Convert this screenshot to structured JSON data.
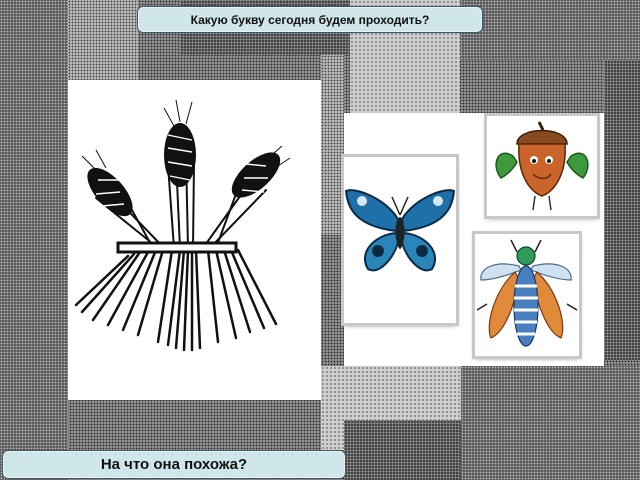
{
  "slide": {
    "question_top": "Какую букву сегодня будем проходить?",
    "question_bottom": "На что она похожа?"
  },
  "images": {
    "wheat": "wheat-sheaf-icon",
    "butterfly": "butterfly-icon",
    "acorn": "acorn-character-icon",
    "bee": "bee-character-icon"
  },
  "colors": {
    "caption_bg": "#cfe6ea",
    "butterfly_blue": "#1f6fa8",
    "acorn_brown": "#c9642a",
    "leaf_green": "#3c9a3c",
    "bee_blue": "#4a7fc0",
    "bee_orange": "#e08a3a"
  }
}
